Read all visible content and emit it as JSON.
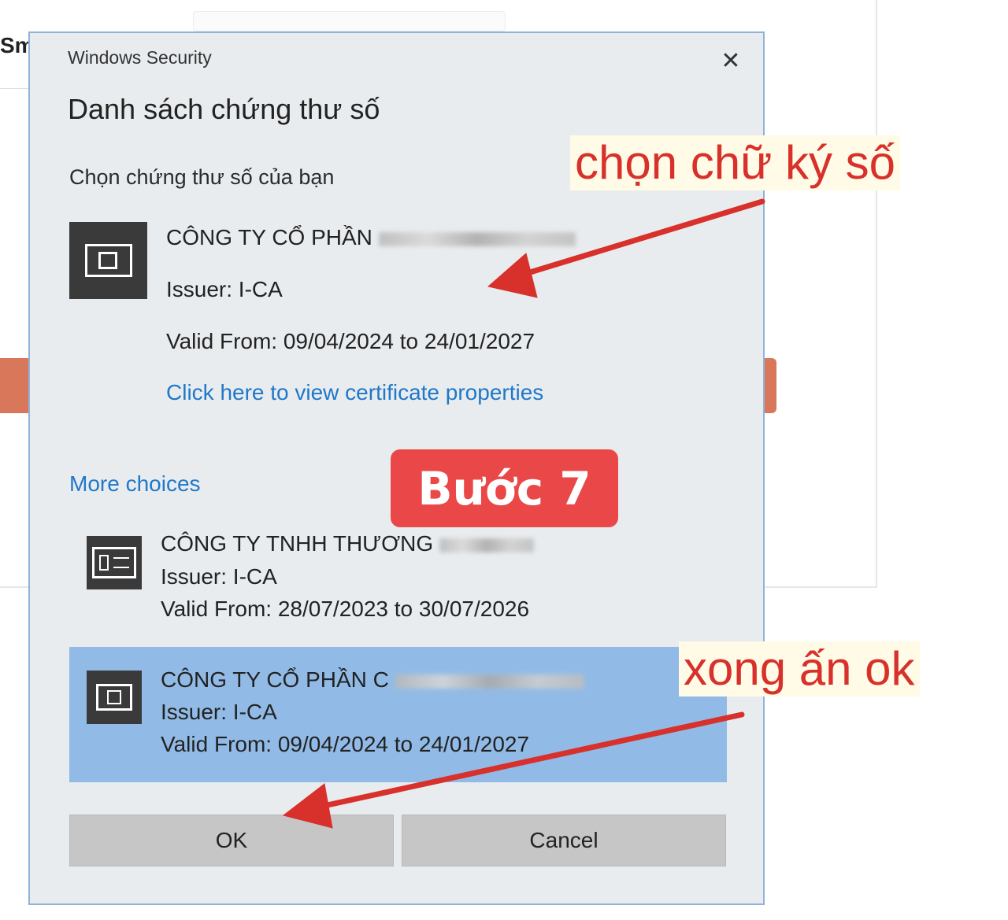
{
  "background": {
    "partial_text": "Sm"
  },
  "dialog": {
    "window_title": "Windows Security",
    "close_glyph": "✕",
    "heading": "Danh sách chứng thư số",
    "subheading": "Chọn chứng thư số của bạn",
    "selected_certificate": {
      "name": "CÔNG TY CỔ PHẦN",
      "issuer": "Issuer: I-CA",
      "valid": "Valid From: 09/04/2024 to 24/01/2027",
      "view_properties_link": "Click here to view certificate properties"
    },
    "more_choices_label": "More choices",
    "choices": [
      {
        "name": "CÔNG TY TNHH THƯƠNG",
        "issuer": "Issuer: I-CA",
        "valid": "Valid From: 28/07/2023 to 30/07/2026",
        "highlighted": false
      },
      {
        "name": "CÔNG TY CỔ PHẦN C",
        "issuer": "Issuer: I-CA",
        "valid": "Valid From: 09/04/2024 to 24/01/2027",
        "highlighted": true
      }
    ],
    "buttons": {
      "ok": "OK",
      "cancel": "Cancel"
    }
  },
  "annotations": {
    "step_badge": "Bước 7",
    "note_select": "chọn chữ ký số",
    "note_ok": "xong ấn ok",
    "arrow_color": "#d8302b"
  },
  "colors": {
    "dialog_bg": "#e9ecef",
    "dialog_border": "#8fb3d9",
    "link": "#1f78c8",
    "highlight_row": "#91bbe6",
    "badge": "#ea4848"
  }
}
